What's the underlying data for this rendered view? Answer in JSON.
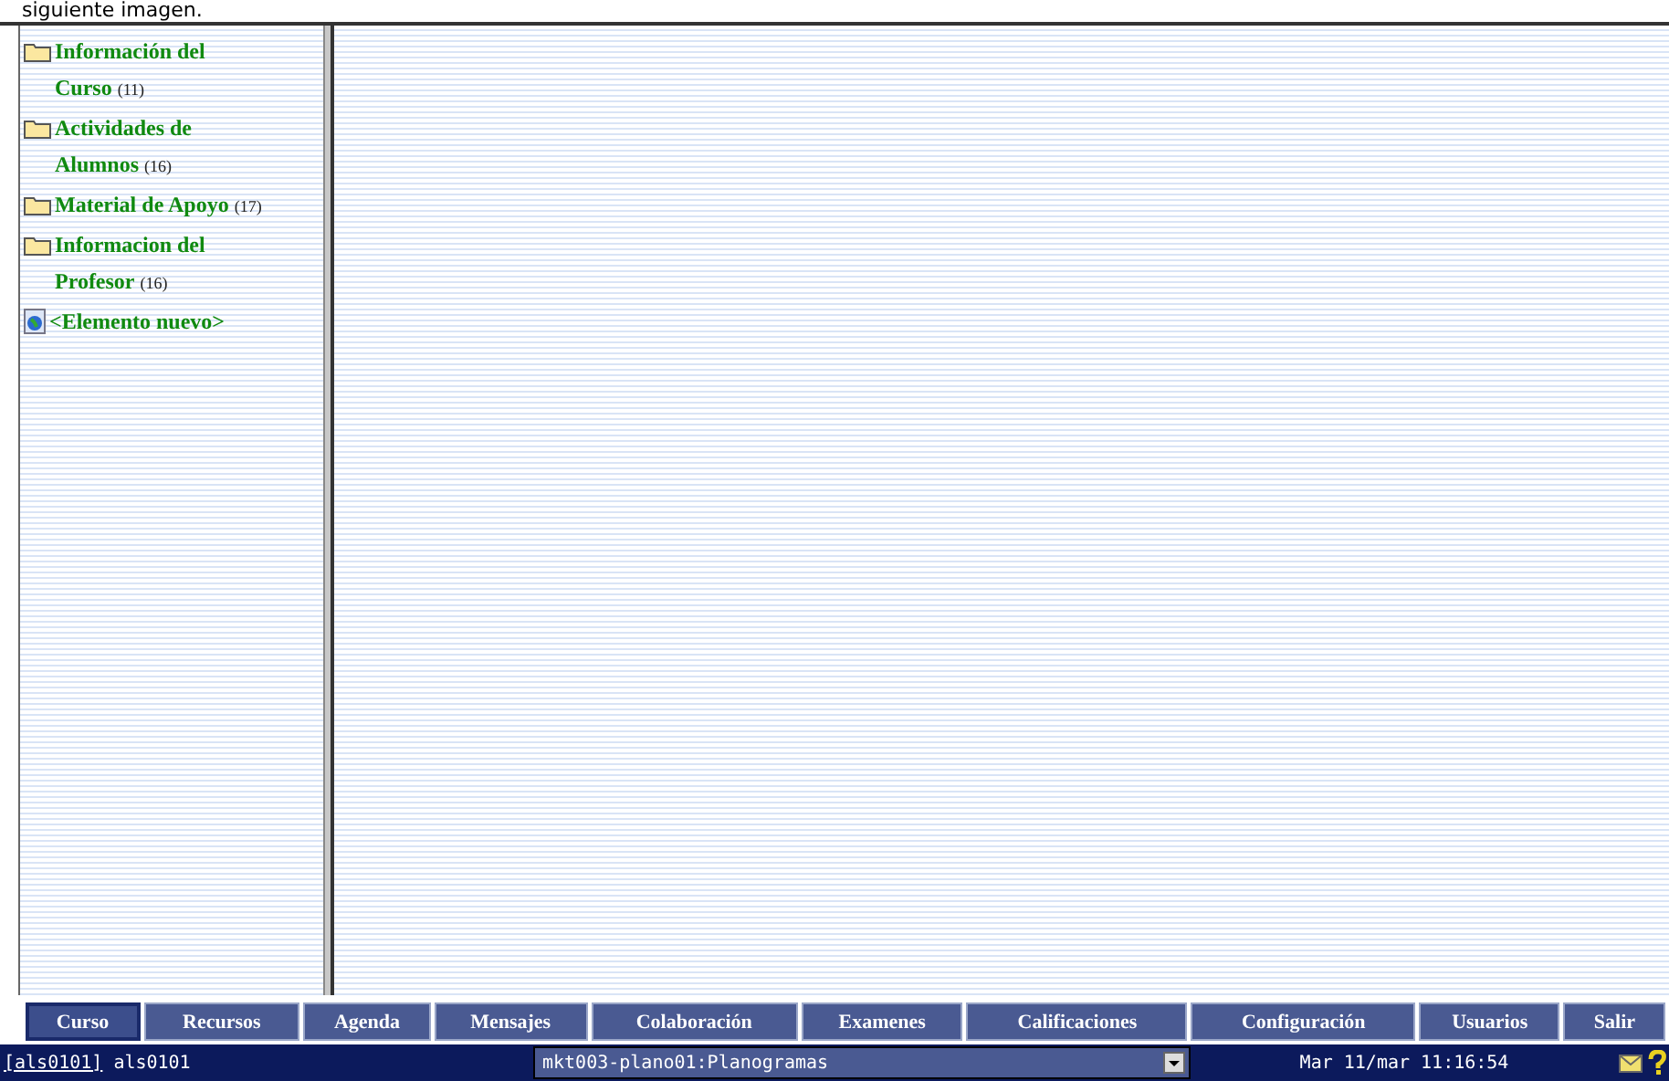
{
  "caption": "siguiente imagen.",
  "sidebar": {
    "items": [
      {
        "kind": "folder",
        "label": "Información del Curso",
        "count": "(11)"
      },
      {
        "kind": "folder",
        "label": "Actividades de Alumnos",
        "count": "(16)"
      },
      {
        "kind": "folder",
        "label": "Material de Apoyo",
        "count": "(17)"
      },
      {
        "kind": "folder",
        "label": "Informacion del Profesor",
        "count": "(16)"
      },
      {
        "kind": "new",
        "label": "<Elemento nuevo>"
      }
    ]
  },
  "tabs": [
    {
      "label": "Curso",
      "selected": true
    },
    {
      "label": "Recursos",
      "selected": false
    },
    {
      "label": "Agenda",
      "selected": false
    },
    {
      "label": "Mensajes",
      "selected": false
    },
    {
      "label": "Colaboración",
      "selected": false
    },
    {
      "label": "Examenes",
      "selected": false
    },
    {
      "label": "Calificaciones",
      "selected": false
    },
    {
      "label": "Configuración",
      "selected": false
    },
    {
      "label": "Usuarios",
      "selected": false
    },
    {
      "label": "Salir",
      "selected": false
    }
  ],
  "status_bar": {
    "user_link": "[als0101]",
    "user": "als0101",
    "course": "mkt003-plano01:Planogramas",
    "datetime": "Mar 11/mar 11:16:54"
  }
}
